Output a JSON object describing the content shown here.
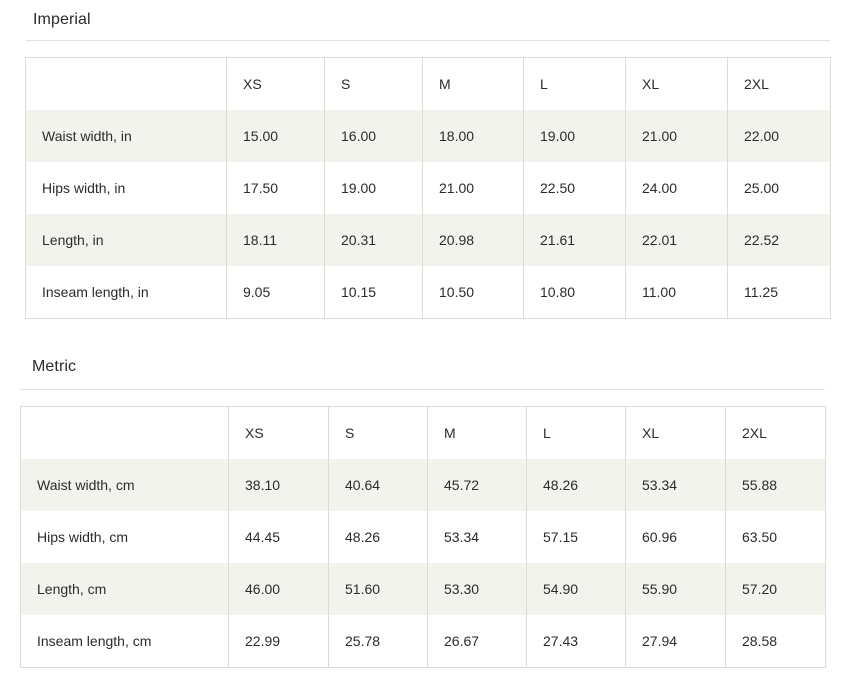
{
  "imperial": {
    "title": "Imperial",
    "header": [
      "",
      "XS",
      "S",
      "M",
      "L",
      "XL",
      "2XL"
    ],
    "rows": [
      {
        "label": "Waist width, in",
        "values": [
          "15.00",
          "16.00",
          "18.00",
          "19.00",
          "21.00",
          "22.00"
        ]
      },
      {
        "label": "Hips width, in",
        "values": [
          "17.50",
          "19.00",
          "21.00",
          "22.50",
          "24.00",
          "25.00"
        ]
      },
      {
        "label": "Length, in",
        "values": [
          "18.11",
          "20.31",
          "20.98",
          "21.61",
          "22.01",
          "22.52"
        ]
      },
      {
        "label": "Inseam length, in",
        "values": [
          "9.05",
          "10.15",
          "10.50",
          "10.80",
          "11.00",
          "11.25"
        ]
      }
    ]
  },
  "metric": {
    "title": "Metric",
    "header": [
      "",
      "XS",
      "S",
      "M",
      "L",
      "XL",
      "2XL"
    ],
    "rows": [
      {
        "label": "Waist width, cm",
        "values": [
          "38.10",
          "40.64",
          "45.72",
          "48.26",
          "53.34",
          "55.88"
        ]
      },
      {
        "label": "Hips width, cm",
        "values": [
          "44.45",
          "48.26",
          "53.34",
          "57.15",
          "60.96",
          "63.50"
        ]
      },
      {
        "label": "Length, cm",
        "values": [
          "46.00",
          "51.60",
          "53.30",
          "54.90",
          "55.90",
          "57.20"
        ]
      },
      {
        "label": "Inseam length, cm",
        "values": [
          "22.99",
          "25.78",
          "26.67",
          "27.43",
          "27.94",
          "28.58"
        ]
      }
    ]
  }
}
